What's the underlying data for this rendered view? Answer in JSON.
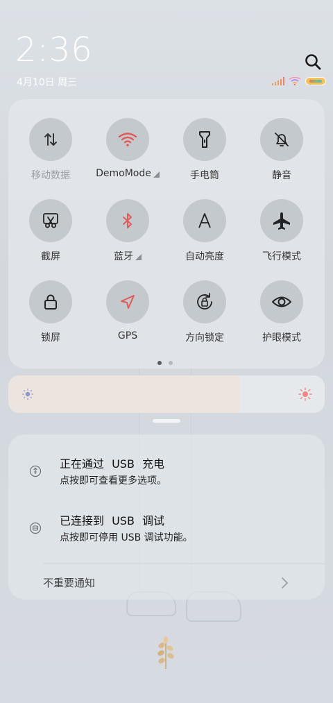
{
  "status": {
    "time": "2:36",
    "date": "4月10日 周三"
  },
  "quick_settings": {
    "tiles": [
      {
        "id": "mobile-data",
        "label": "移动数据",
        "icon": "arrows-updown-icon",
        "active": false,
        "disabled": true,
        "expandable": false
      },
      {
        "id": "wifi",
        "label": "DemoMode",
        "icon": "wifi-icon",
        "active": true,
        "disabled": false,
        "expandable": true
      },
      {
        "id": "flashlight",
        "label": "手电筒",
        "icon": "flashlight-icon",
        "active": false,
        "disabled": false,
        "expandable": false
      },
      {
        "id": "mute",
        "label": "静音",
        "icon": "bell-off-icon",
        "active": false,
        "disabled": false,
        "expandable": false
      },
      {
        "id": "screenshot",
        "label": "截屏",
        "icon": "scissors-icon",
        "active": false,
        "disabled": false,
        "expandable": false
      },
      {
        "id": "bluetooth",
        "label": "蓝牙",
        "icon": "bluetooth-icon",
        "active": true,
        "disabled": false,
        "expandable": true
      },
      {
        "id": "auto-brightness",
        "label": "自动亮度",
        "icon": "letter-a-icon",
        "active": false,
        "disabled": false,
        "expandable": false
      },
      {
        "id": "airplane",
        "label": "飞行模式",
        "icon": "airplane-icon",
        "active": false,
        "disabled": false,
        "expandable": false
      },
      {
        "id": "lock-screen",
        "label": "锁屏",
        "icon": "lock-icon",
        "active": false,
        "disabled": false,
        "expandable": false
      },
      {
        "id": "gps",
        "label": "GPS",
        "icon": "location-arrow-icon",
        "active": true,
        "disabled": false,
        "expandable": false
      },
      {
        "id": "rotation-lock",
        "label": "方向锁定",
        "icon": "rotation-lock-icon",
        "active": false,
        "disabled": false,
        "expandable": false
      },
      {
        "id": "eye-care",
        "label": "护眼模式",
        "icon": "eye-icon",
        "active": false,
        "disabled": false,
        "expandable": false
      }
    ],
    "page_count": 2,
    "current_page": 1
  },
  "brightness": {
    "level": 0.73
  },
  "notifications": [
    {
      "title": "正在通过 USB 充电",
      "subtitle": "点按即可查看更多选项。",
      "icon": "usb-charge-icon"
    },
    {
      "title": "已连接到 USB 调试",
      "subtitle": "点按即可停用 USB 调试功能。",
      "icon": "android-debug-icon"
    }
  ],
  "unimportant_label": "不重要通知",
  "colors": {
    "accent_red": "#e05a5a",
    "tile_bg": "#c4c9ce"
  }
}
